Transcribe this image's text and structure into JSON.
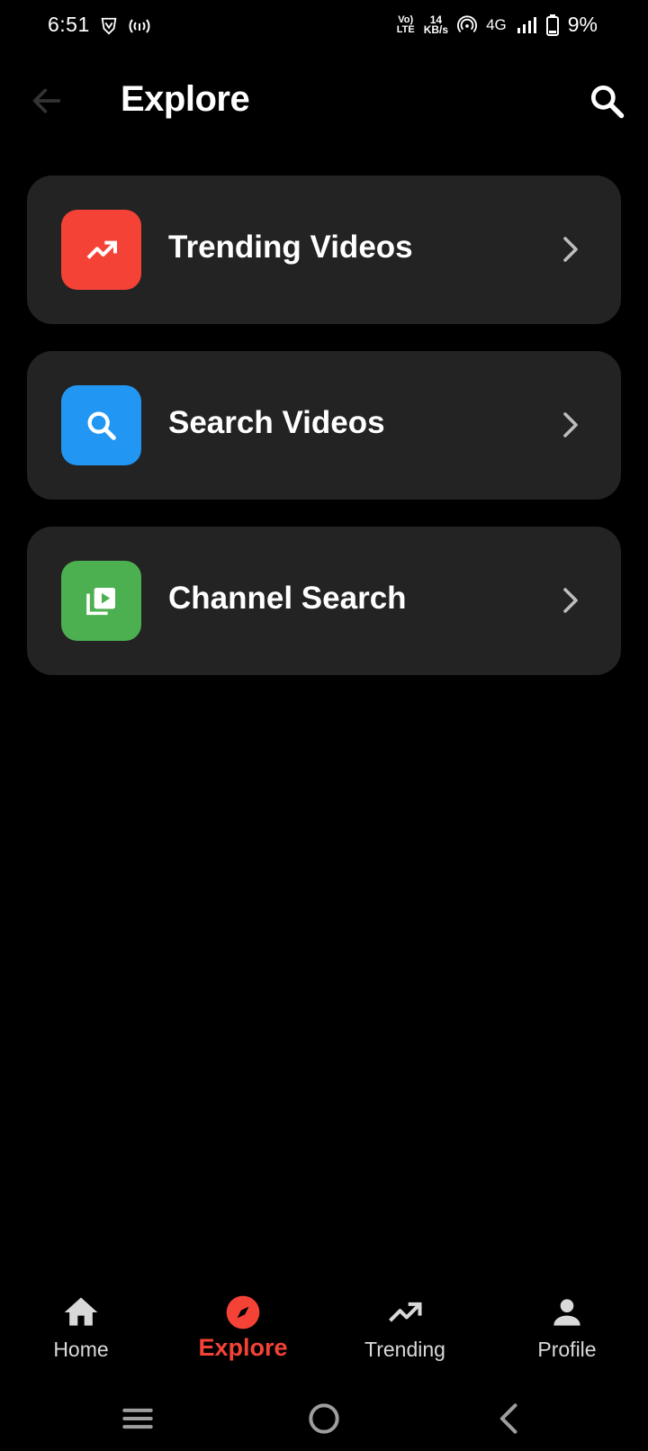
{
  "status_bar": {
    "time": "6:51",
    "volte_top": "Vo)",
    "volte_bottom": "LTE",
    "speed_top": "14",
    "speed_bottom": "KB/s",
    "network": "4G",
    "battery": "9%"
  },
  "header": {
    "title": "Explore"
  },
  "menu": [
    {
      "label": "Trending Videos",
      "icon": "trending-up-icon",
      "color": "#f44336"
    },
    {
      "label": "Search Videos",
      "icon": "search-icon",
      "color": "#2196f3"
    },
    {
      "label": "Channel Search",
      "icon": "video-library-icon",
      "color": "#4caf50"
    }
  ],
  "bottom_nav": {
    "items": [
      {
        "label": "Home",
        "icon": "home-icon",
        "active": false
      },
      {
        "label": "Explore",
        "icon": "compass-icon",
        "active": true
      },
      {
        "label": "Trending",
        "icon": "trending-up-icon",
        "active": false
      },
      {
        "label": "Profile",
        "icon": "person-icon",
        "active": false
      }
    ],
    "active_color": "#f44336"
  }
}
